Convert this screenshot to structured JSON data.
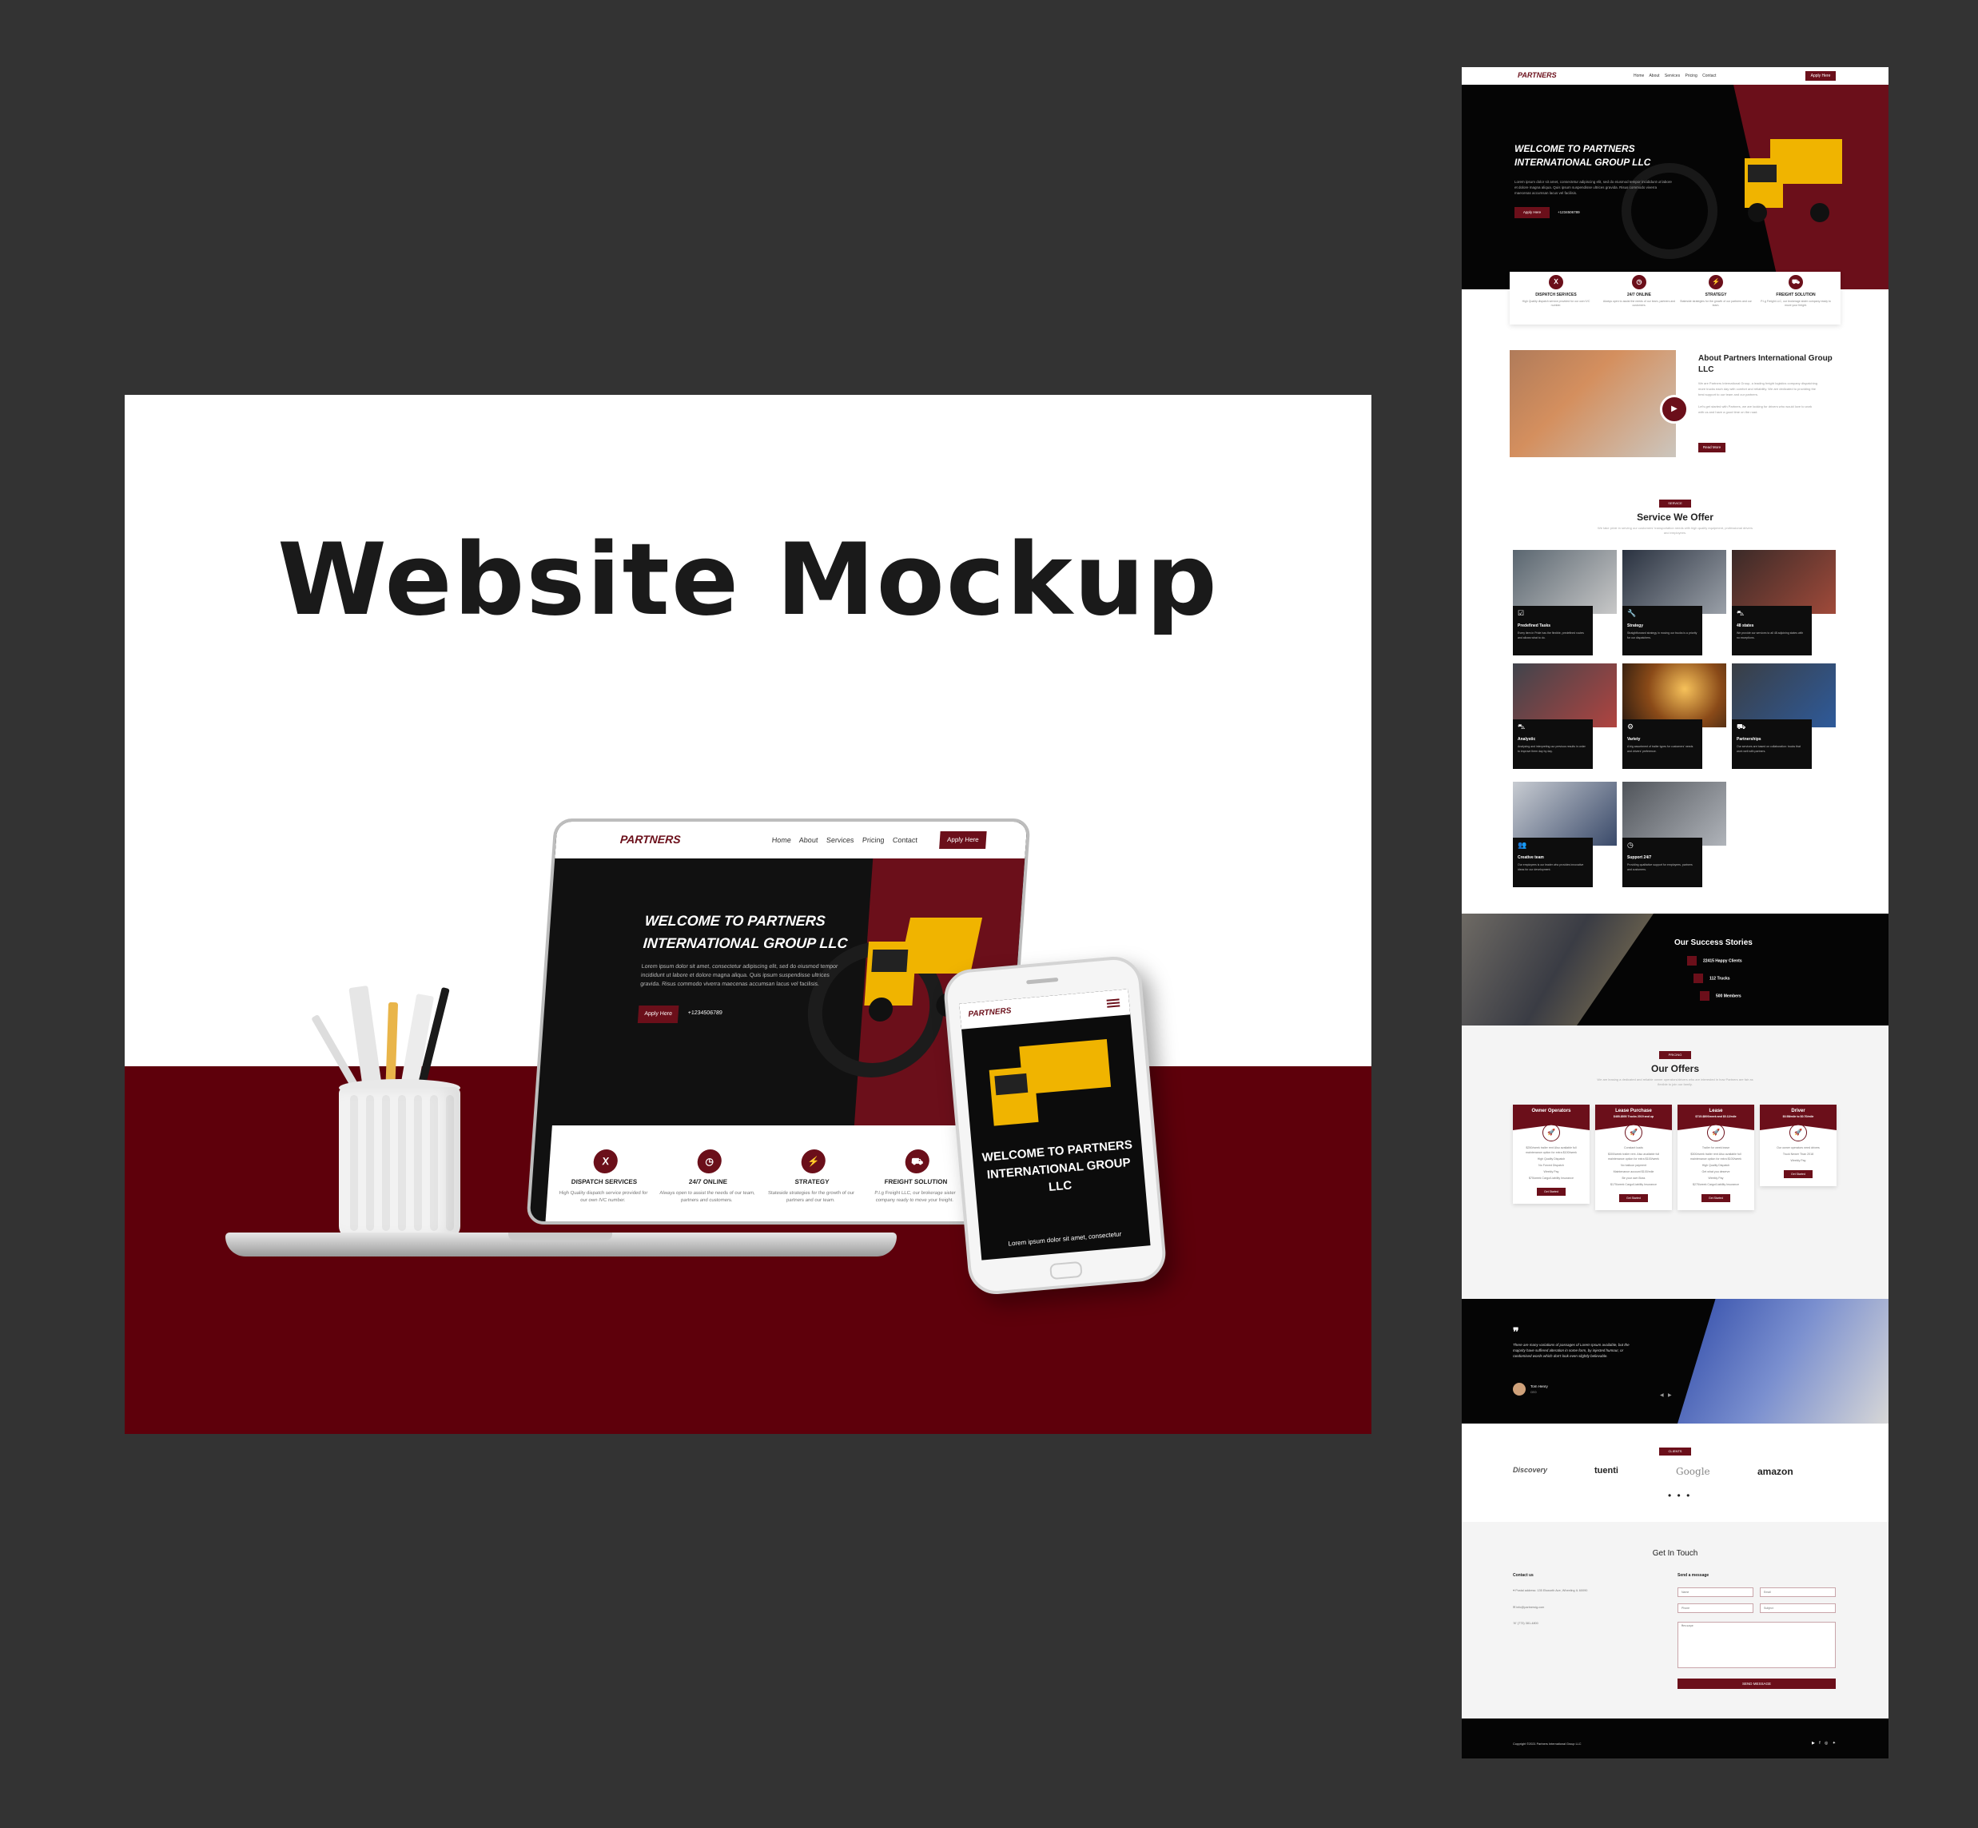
{
  "mockup": {
    "title": "Website Mockup",
    "laptop": {
      "logo": "PARTNERS",
      "menu": "Home About Services Pricing Contact",
      "apply": "Apply Here",
      "hero_title": "WELCOME TO PARTNERS INTERNATIONAL GROUP LLC",
      "hero_body": "Lorem ipsum dolor sit amet, consectetur adipiscing elit, sed do eiusmod tempor incididunt ut labore et dolore magna aliqua. Quis ipsum suspendisse ultrices gravida. Risus commodo viverra maecenas accumsan lacus vel facilisis.",
      "hero_button": "Apply Here",
      "phone": "+1234506789",
      "cards": [
        {
          "icon": "Ⅹ",
          "title": "DISPATCH SERVICES",
          "text": "High Quality dispatch service provided for our own IVC number."
        },
        {
          "icon": "◷",
          "title": "24/7 ONLINE",
          "text": "Always open to assist the needs of our team, partners and customers."
        },
        {
          "icon": "⚡",
          "title": "STRATEGY",
          "text": "Stateside strategies for the growth of our partners and our team."
        },
        {
          "icon": "⛟",
          "title": "FREIGHT SOLUTION",
          "text": "P.I.g Freight LLC, our brokerage sister company ready to move your freight."
        }
      ]
    },
    "phone": {
      "logo": "PARTNERS",
      "hero_title": "WELCOME TO PARTNERS INTERNATIONAL GROUP LLC",
      "hero_body": "Lorem ipsum dolor sit amet, consectetur"
    }
  },
  "site": {
    "nav": {
      "logo": "PARTNERS",
      "menu": "Home About Services Pricing Contact",
      "apply": "Apply Here"
    },
    "hero": {
      "title": "WELCOME TO PARTNERS INTERNATIONAL GROUP LLC",
      "body": "Lorem ipsum dolor sit amet, consectetur adipiscing elit, sed do eiusmod tempor incididunt ut labore et dolore magna aliqua. Quis ipsum suspendisse ultrices gravida. Risus commodo viverra maecenas accumsan lacus vel facilisis.",
      "button": "Apply Here",
      "phone": "+1234506789"
    },
    "features": [
      {
        "icon": "Ⅹ",
        "title": "DISPATCH SERVICES",
        "text": "High Quality dispatch service provided for our own IVC number."
      },
      {
        "icon": "◷",
        "title": "24/7 ONLINE",
        "text": "Always open to assist the needs of our team, partners and customers."
      },
      {
        "icon": "⚡",
        "title": "STRATEGY",
        "text": "Stateside strategies for the growth of our partners and our team."
      },
      {
        "icon": "⛟",
        "title": "FREIGHT SOLUTION",
        "text": "P.I.g Freight LLC, our brokerage sister company ready to move your freight."
      }
    ],
    "about": {
      "title": "About Partners International Group LLC",
      "body": "We are Partners International Group, a leading freight logistics company dispatching more trucks each day with comfort and reliability. We are dedicated to providing the best support to our team and our partners.",
      "body2": "Let's get started with Partners, we are looking for drivers who would love to work with us and have a good time on the road.",
      "button": "Read More"
    },
    "services": {
      "tag": "SERVICE",
      "title": "Service We Offer",
      "subtitle": "We take pride in serving our customers' transportation needs with high quality equipment, professional drivers and employees.",
      "items": [
        {
          "icon": "☑",
          "name": "Predefined Tasks",
          "text": "Every item in Pride has the flexible, predefined routes and allows what to do."
        },
        {
          "icon": "🔧",
          "name": "Strategy",
          "text": "Straightforward strategy in moving our trucks is a priority for our dispatchers."
        },
        {
          "icon": "⛍",
          "name": "48 states",
          "text": "We provide our services to all 48 adjoining states with no exceptions."
        },
        {
          "icon": "⛍",
          "name": "Analystic",
          "text": "Analyzing and interpreting our previous results in order to improve them day by day."
        },
        {
          "icon": "⚙",
          "name": "Variety",
          "text": "A big assortment of trailer types for customers' needs and drivers' preference."
        },
        {
          "icon": "⛟",
          "name": "Partnerships",
          "text": "Our services are based on collaboration: trucks that work well with partners."
        },
        {
          "icon": "👥",
          "name": "Creative team",
          "text": "Our employees is our leader who provides innovative ideas for our development."
        },
        {
          "icon": "◷",
          "name": "Support 24/7",
          "text": "Providing qualitative support for employees, partners and customers."
        }
      ]
    },
    "success": {
      "title": "Our Success Stories",
      "items": [
        "22415 Happy Clients",
        "112 Trucks",
        "500 Members"
      ]
    },
    "offers": {
      "tag": "PRICING",
      "title": "Our Offers",
      "subtitle": "We are leasing a dedicated and reliable owner operators/drivers who are interested in how Partners are fair as flexible to join our family.",
      "plans": [
        {
          "name": "Owner Operators",
          "sub": "",
          "features": [
            "$250/week trailer rent Also available full maintenance option for extra $100/week",
            "High Quality Dispatch",
            "No Forced Dispatch",
            "Weekly Pay",
            "$75/week Cargo/Liability Insurance"
          ],
          "button": "Get Started"
        },
        {
          "name": "Lease Purchase",
          "sub": "$485-$800 Trucks 2019 and up",
          "features": [
            "Constant loads",
            "$300/week trailer rent. Also available full maintenance option for extra $100/week",
            "No balloon payment",
            "Maintenance account $100/mile",
            "Be your own Boss",
            "$175/week Cargo/Liability Insurance"
          ],
          "button": "Get Started"
        },
        {
          "name": "Lease",
          "sub": "$715-$800/week and $0.12/mile",
          "features": [
            "Trailer for week lease",
            "$300/week trailer rent Also available full maintenance option for extra $100/week",
            "High Quality Dispatch",
            "Get what you deserve",
            "Weekly Pay",
            "$275/week Cargo/Liability Insurance"
          ],
          "button": "Get Started"
        },
        {
          "name": "Driver",
          "sub": "$0.58/mile to $0.70/mile",
          "features": [
            "Our owner operators need drivers",
            "Truck Newer Than 2018",
            "Weekly Pay"
          ],
          "button": "Get Started"
        }
      ]
    },
    "testimonial": {
      "quote_mark": "❞",
      "text": "There are many variations of passages of Lorem Ipsum available, but the majority have suffered alteration in some form, by injected humour, or randomised words which don't look even slightly believable.",
      "name": "Tom Henry",
      "role": "CEO"
    },
    "clients": {
      "tag": "CLIENTS",
      "logos": [
        "Discovery",
        "tuenti",
        "Google",
        "amazon"
      ],
      "more": "• • •"
    },
    "contact": {
      "title": "Get In Touch",
      "left_heading": "Contact us",
      "items": [
        "Postal address: 135 Elsworth Ave, Wheeling IL 60090",
        "info@partnersig.com",
        "(773) 381-4800"
      ],
      "right_heading": "Send a message",
      "placeholders": {
        "name": "Name",
        "email": "Email",
        "phone": "Phone",
        "subject": "Subject",
        "message": "Message"
      },
      "button": "SEND MESSAGE"
    },
    "footer": {
      "copyright": "Copyright ©2021 Partners International Group LLC",
      "social": "▶ f ◎ ✦"
    }
  },
  "colors": {
    "background": "#333333",
    "brand": "#6b0f1a",
    "deep_red": "#5e000b",
    "dark": "#050505",
    "truck": "#f0b400"
  }
}
